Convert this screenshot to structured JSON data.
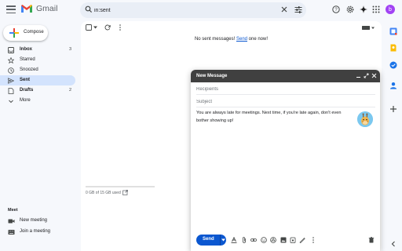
{
  "app": {
    "logo_text": "Gmail",
    "avatar_letter": "b",
    "accent_color": "#0b57d0",
    "avatar_color": "#a142f4"
  },
  "search": {
    "value": "in:sent"
  },
  "compose_button": {
    "label": "Compose"
  },
  "sidebar": {
    "items": [
      {
        "label": "Inbox",
        "count": "3",
        "icon": "inbox-icon",
        "bold": true
      },
      {
        "label": "Starred",
        "count": "",
        "icon": "star-icon",
        "bold": false
      },
      {
        "label": "Snoozed",
        "count": "",
        "icon": "clock-icon",
        "bold": false
      },
      {
        "label": "Sent",
        "count": "",
        "icon": "send-icon",
        "bold": true,
        "active": true
      },
      {
        "label": "Drafts",
        "count": "2",
        "icon": "draft-icon",
        "bold": true
      },
      {
        "label": "More",
        "count": "",
        "icon": "chevron-down-icon",
        "bold": false
      }
    ]
  },
  "meet": {
    "title": "Meet",
    "items": [
      {
        "label": "New meeting",
        "icon": "video-icon"
      },
      {
        "label": "Join a meeting",
        "icon": "keyboard-icon"
      }
    ]
  },
  "main": {
    "empty_prefix": "No sent messages! ",
    "empty_link": "Send",
    "empty_suffix": " one now!",
    "storage_text": "0 GB of 15 GB used",
    "storage_fraction": 0.0
  },
  "compose_window": {
    "title": "New Message",
    "recipients_placeholder": "Recipients",
    "subject_placeholder": "Subject",
    "body": "You are always late for meetings. Next time, if you're late again, don't even bother showing up!",
    "send_label": "Send"
  }
}
